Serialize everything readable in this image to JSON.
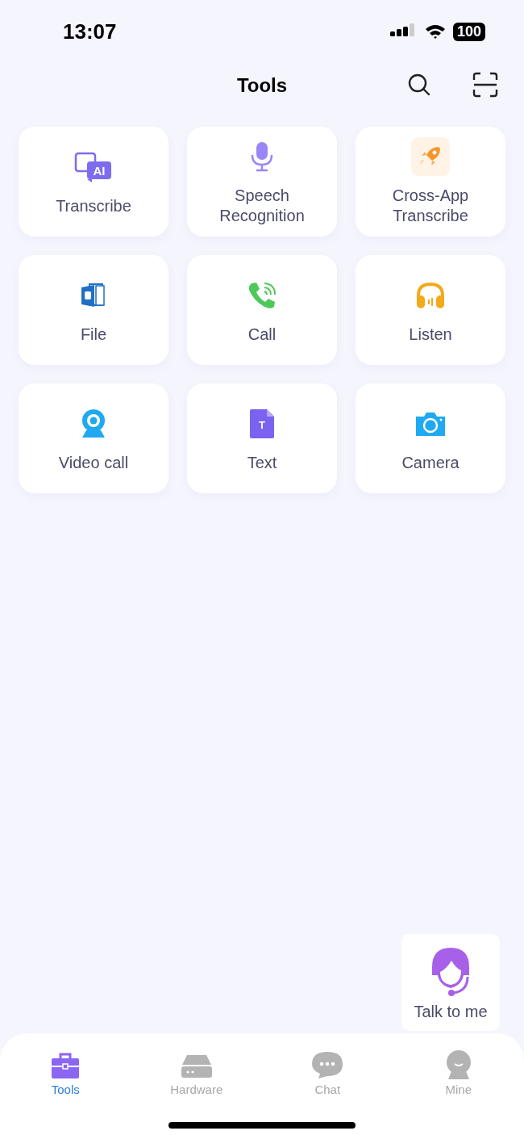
{
  "status_bar": {
    "time": "13:07",
    "battery": "100"
  },
  "header": {
    "title": "Tools"
  },
  "tools": [
    {
      "kind": "ai",
      "label": "Transcribe",
      "icon_text": "AI"
    },
    {
      "kind": "mic",
      "label": "Speech Recognition"
    },
    {
      "kind": "rocket",
      "label": "Cross-App Transcribe"
    },
    {
      "kind": "file",
      "label": "File"
    },
    {
      "kind": "call",
      "label": "Call"
    },
    {
      "kind": "listen",
      "label": "Listen"
    },
    {
      "kind": "video",
      "label": "Video call"
    },
    {
      "kind": "text",
      "label": "Text",
      "icon_text": "T"
    },
    {
      "kind": "camera",
      "label": "Camera"
    }
  ],
  "assistant": {
    "label": "Talk to me"
  },
  "tab_bar": [
    {
      "kind": "tools",
      "label": "Tools",
      "selected": true
    },
    {
      "kind": "hardware",
      "label": "Hardware",
      "selected": false
    },
    {
      "kind": "chat",
      "label": "Chat",
      "selected": false
    },
    {
      "kind": "mine",
      "label": "Mine",
      "selected": false
    }
  ]
}
